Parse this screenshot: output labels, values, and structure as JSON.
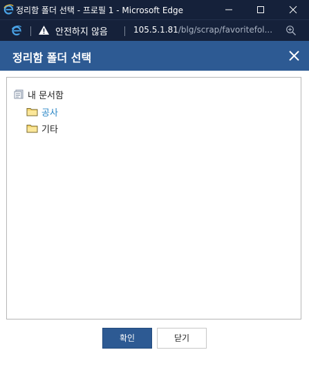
{
  "window": {
    "title": "정리함 폴더 선택 - 프로필 1 - Microsoft Edge",
    "controls": {
      "minimize_icon": "minimize-icon",
      "maximize_icon": "maximize-icon",
      "close_icon": "close-icon"
    }
  },
  "address_bar": {
    "security_label": "안전하지 않음",
    "url_host": "105.5.1.81",
    "url_path": "/blg/scrap/favoritefol..."
  },
  "dialog": {
    "title": "정리함 폴더 선택",
    "colors": {
      "header": "#2d5a93",
      "selected_folder_text": "#2a86c6"
    }
  },
  "tree": {
    "root": {
      "label": "내 문서함",
      "icon": "document-icon"
    },
    "folders": [
      {
        "label": "공사",
        "icon": "folder-icon",
        "highlighted": true
      },
      {
        "label": "기타",
        "icon": "folder-icon",
        "highlighted": false
      }
    ]
  },
  "buttons": {
    "confirm": "확인",
    "close": "닫기"
  }
}
